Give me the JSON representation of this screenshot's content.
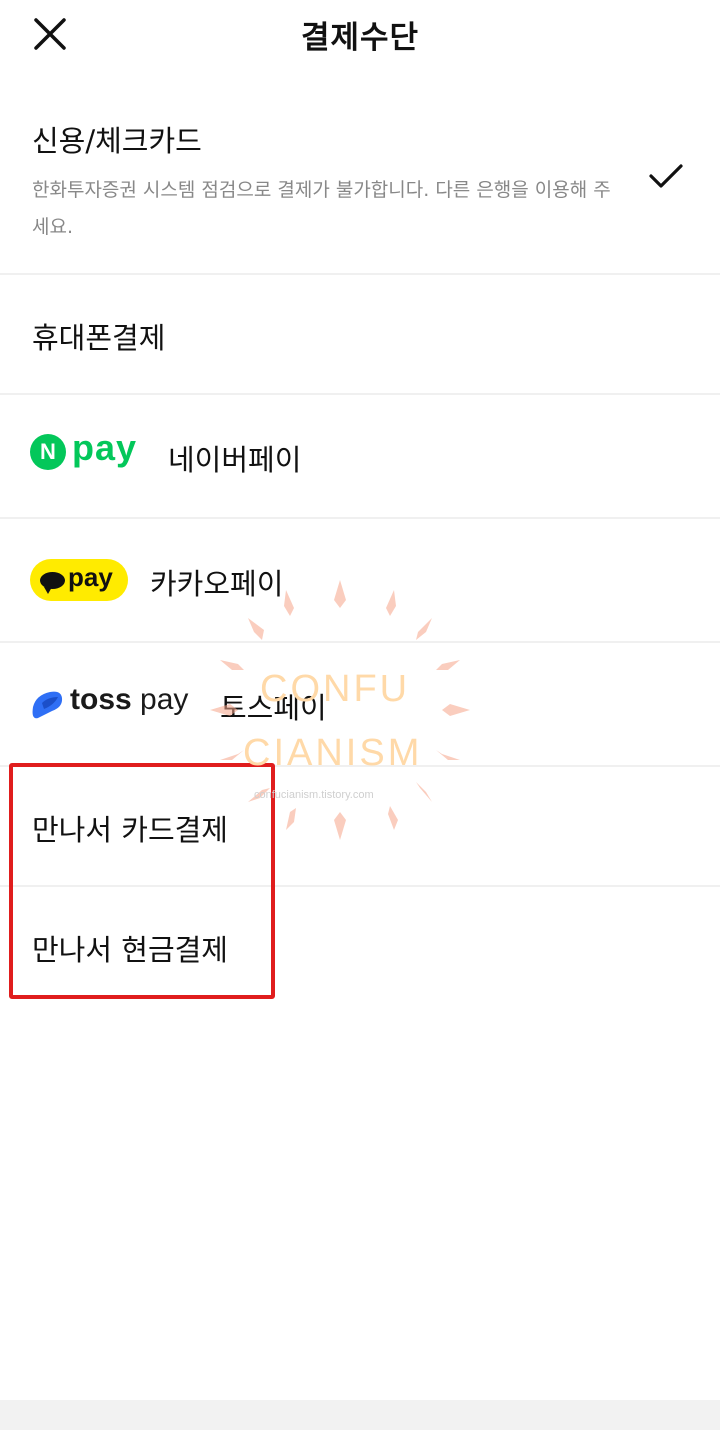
{
  "header": {
    "title": "결제수단",
    "close_icon": "close-icon"
  },
  "payment_methods": [
    {
      "label": "신용/체크카드",
      "notice": "한화투자증권 시스템 점검으로 결제가 불가합니다. 다른 은행을 이용해 주세요.",
      "selected": true,
      "icon": "check-icon"
    },
    {
      "label": "휴대폰결제"
    },
    {
      "label": "네이버페이",
      "logo": {
        "badge": "N",
        "text": "pay",
        "color": "#03c75a"
      }
    },
    {
      "label": "카카오페이",
      "logo": {
        "text": "pay",
        "color": "#ffeb00"
      }
    },
    {
      "label": "토스페이",
      "logo": {
        "text_bold": "toss",
        "text": " pay",
        "color": "#2f6ff5"
      }
    },
    {
      "label": "만나서 카드결제"
    },
    {
      "label": "만나서 현금결제"
    }
  ],
  "highlight": {
    "color": "#e01d1d"
  },
  "watermark": {
    "line1": "CONFU",
    "line2": "CIANISM",
    "url": "confucianism.tistory.com"
  }
}
